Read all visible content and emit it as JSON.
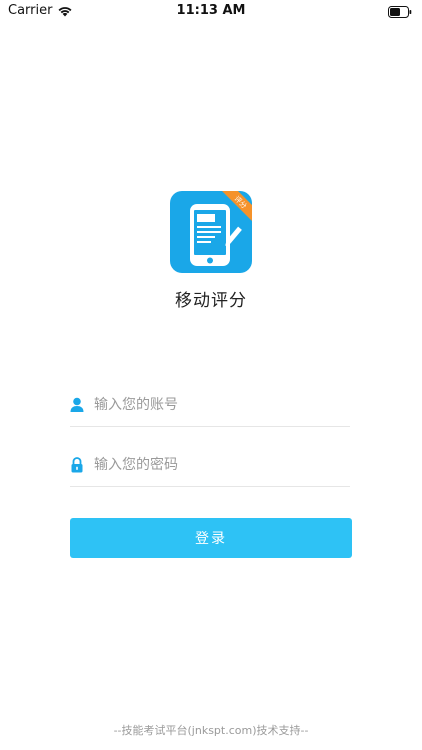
{
  "status_bar": {
    "carrier": "Carrier",
    "time": "11:13 AM"
  },
  "app": {
    "name": "移动评分",
    "logo_badge": "评分",
    "logo_color": "#1aa7e8",
    "badge_color": "#f5922a"
  },
  "form": {
    "account_placeholder": "输入您的账号",
    "password_placeholder": "输入您的密码",
    "login_label": "登录",
    "accent_color": "#2ec2f5"
  },
  "footer": {
    "text": "--技能考试平台(jnkspt.com)技术支持--"
  }
}
